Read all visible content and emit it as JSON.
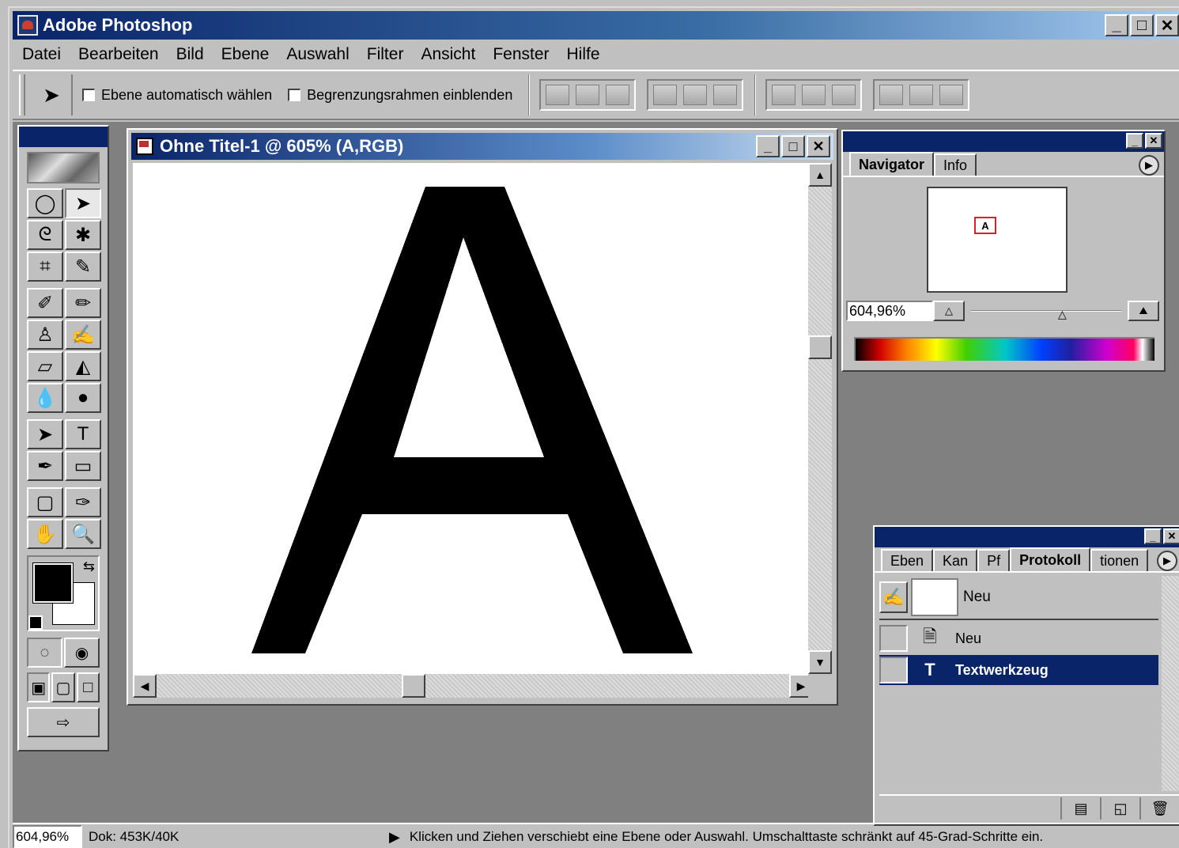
{
  "app": {
    "title": "Adobe Photoshop",
    "window_buttons": [
      "_",
      "□",
      "✕"
    ]
  },
  "menu": [
    "Datei",
    "Bearbeiten",
    "Bild",
    "Ebene",
    "Auswahl",
    "Filter",
    "Ansicht",
    "Fenster",
    "Hilfe"
  ],
  "options": {
    "auto_select_label": "Ebene automatisch wählen",
    "auto_select_checked": false,
    "bounding_box_label": "Begrenzungsrahmen einblenden",
    "bounding_box_checked": false
  },
  "document": {
    "title": "Ohne Titel-1 @ 605% (A,RGB)",
    "content_letter": "A"
  },
  "navigator": {
    "tabs": [
      "Navigator",
      "Info"
    ],
    "active_tab": "Navigator",
    "zoom": "604,96%",
    "preview_letter": "A"
  },
  "history_palette": {
    "tabs": [
      "Eben",
      "Kan",
      "Pf",
      "Protokoll",
      "tionen"
    ],
    "active_tab": "Protokoll",
    "snapshot_label": "Neu",
    "items": [
      {
        "label": "Neu",
        "icon": "new-document-icon",
        "selected": false
      },
      {
        "label": "Textwerkzeug",
        "icon": "type-tool-icon",
        "selected": true
      }
    ]
  },
  "status": {
    "zoom": "604,96%",
    "doc_size": "Dok: 453K/40K",
    "hint": "Klicken und Ziehen verschiebt eine Ebene oder Auswahl. Umschalttaste schränkt auf 45-Grad-Schritte ein."
  },
  "colors": {
    "titlebar": "#0a246a",
    "face": "#c0c0c0",
    "workspace": "#808080",
    "foreground": "#000000",
    "background": "#ffffff",
    "selection": "#0a246a",
    "navigator_box": "#e02020"
  }
}
